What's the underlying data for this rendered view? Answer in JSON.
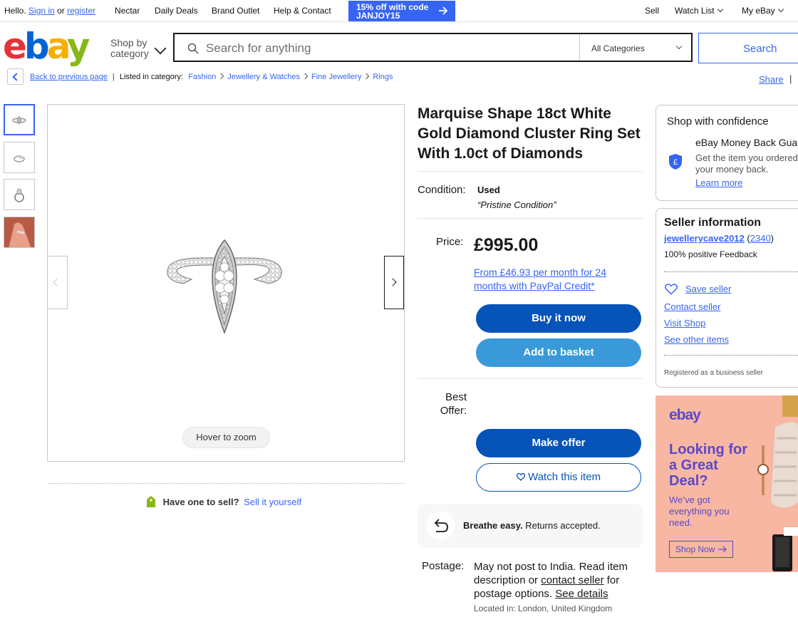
{
  "topbar": {
    "hello": "Hello.",
    "sign_in": "Sign in",
    "or": "or",
    "register": "register",
    "nectar": "Nectar",
    "daily_deals": "Daily Deals",
    "brand_outlet": "Brand Outlet",
    "help_contact": "Help & Contact",
    "promo_text": "15% off with code JANJOY15",
    "sell": "Sell",
    "watch_list": "Watch List",
    "my_ebay": "My eBay"
  },
  "header": {
    "shop_by_category": "Shop by category",
    "search_placeholder": "Search for anything",
    "category_select": "All Categories",
    "search_button": "Search"
  },
  "breadcrumb": {
    "back": "Back to previous page",
    "listed_in": "Listed in category:",
    "items": [
      "Fashion",
      "Jewellery & Watches",
      "Fine Jewellery",
      "Rings"
    ],
    "share": "Share"
  },
  "gallery": {
    "hover_to_zoom": "Hover to zoom",
    "have_one": "Have one to sell?",
    "sell_it": "Sell it yourself"
  },
  "item": {
    "title": "Marquise Shape 18ct White Gold Diamond Cluster Ring Set With 1.0ct of Diamonds",
    "condition_label": "Condition:",
    "condition_value": "Used",
    "condition_note": "“Pristine Condition”",
    "price_label": "Price:",
    "price": "£995.00",
    "finance": "From £46.93 per month for 24 months with PayPal Credit*",
    "buy_now": "Buy it now",
    "add_to_basket": "Add to basket",
    "best_offer_label": "Best Offer:",
    "make_offer": "Make offer",
    "watch": "Watch this item",
    "returns_bold": "Breathe easy.",
    "returns_text": " Returns accepted.",
    "postage_label": "Postage:",
    "postage_1": "May not post to India. Read item description or ",
    "postage_contact": "contact seller",
    "postage_2": " for postage options. ",
    "postage_details": "See details",
    "located": "Located in: London, United Kingdom"
  },
  "confidence": {
    "heading": "Shop with confidence",
    "guarantee_title": "eBay Money Back Guarantee",
    "guarantee_text": "Get the item you ordered or your money back.",
    "learn_more": "Learn more"
  },
  "seller": {
    "heading": "Seller information",
    "name": "jewellerycave2012",
    "score": "2340",
    "feedback": "100% positive Feedback",
    "save": "Save seller",
    "contact": "Contact seller",
    "visit": "Visit Shop",
    "other": "See other items",
    "business": "Registered as a business seller"
  },
  "ad": {
    "logo": "ebay",
    "headline": "Looking for a Great Deal?",
    "sub": "We’ve got everything you need.",
    "cta": "Shop Now"
  }
}
